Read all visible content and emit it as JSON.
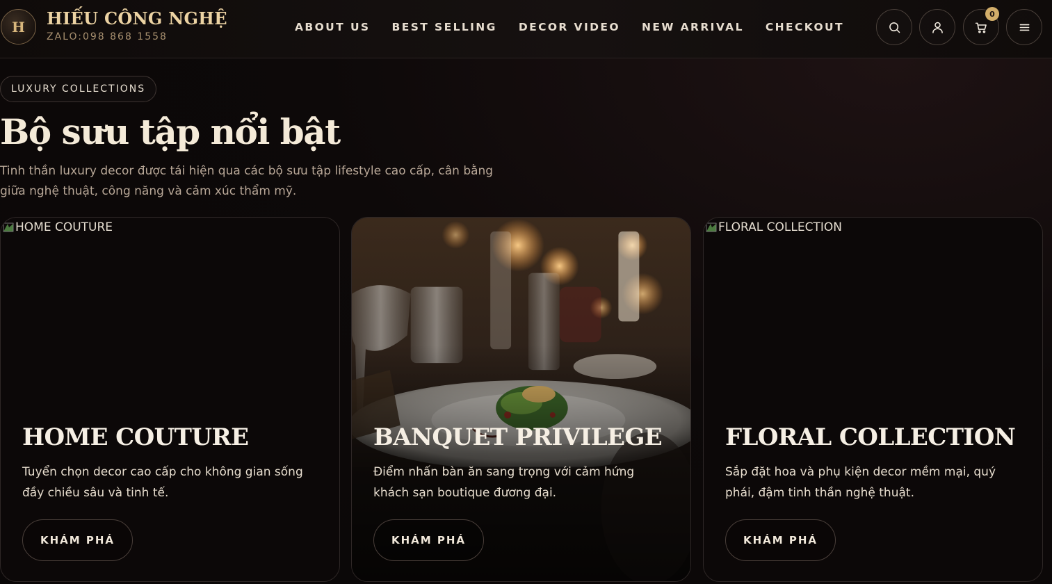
{
  "header": {
    "logo_letter": "H",
    "brand_name": "HIẾU CÔNG NGHỆ",
    "phone": "ZALO:098 868 1558",
    "nav": [
      "ABOUT US",
      "BEST SELLING",
      "DECOR VIDEO",
      "NEW ARRIVAL",
      "CHECKOUT"
    ],
    "icons": [
      "search-icon",
      "user-icon",
      "cart-icon",
      "menu-icon"
    ],
    "cart_count": "0"
  },
  "section": {
    "eyebrow": "LUXURY COLLECTIONS",
    "title": "Bộ sưu tập nổi bật",
    "description": "Tinh thần luxury decor được tái hiện qua các bộ sưu tập lifestyle cao cấp, cân bằng giữa nghệ thuật, công năng và cảm xúc thẩm mỹ."
  },
  "cards": [
    {
      "alt": "HOME COUTURE",
      "title": "HOME COUTURE",
      "description": "Tuyển chọn decor cao cấp cho không gian sống đầy chiều sâu và tinh tế.",
      "button": "KHÁM PHÁ"
    },
    {
      "alt": "",
      "title": "BANQUET PRIVILEGE",
      "description": "Điểm nhấn bàn ăn sang trọng với cảm hứng khách sạn boutique đương đại.",
      "button": "KHÁM PHÁ"
    },
    {
      "alt": "FLORAL COLLECTION",
      "title": "FLORAL COLLECTION",
      "description": "Sắp đặt hoa và phụ kiện decor mềm mại, quý phái, đậm tinh thần nghệ thuật.",
      "button": "KHÁM PHÁ"
    }
  ],
  "colors": {
    "background": "#0d0909",
    "gold_accent": "#d2ae6a",
    "brand_text": "#ecd3a3"
  }
}
